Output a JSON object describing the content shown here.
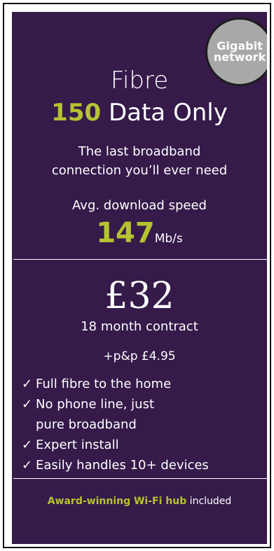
{
  "badge": {
    "line1": "Gigabit",
    "line2": "network"
  },
  "plan": {
    "title_line1": "Fibre",
    "speed_tier": "150",
    "title_rest": " Data Only",
    "tagline_line1": "The last broadband",
    "tagline_line2": "connection you’ll ever need"
  },
  "speed": {
    "label": "Avg. download speed",
    "value": "147",
    "unit": "Mb/s"
  },
  "pricing": {
    "price": "£32",
    "contract": "18 month contract",
    "postage": "+p&p £4.95"
  },
  "features": [
    {
      "tick": "✓",
      "lines": [
        "Full fibre to the home"
      ]
    },
    {
      "tick": "✓",
      "lines": [
        "No phone line, just",
        "pure broadband"
      ]
    },
    {
      "tick": "✓",
      "lines": [
        "Expert install"
      ]
    },
    {
      "tick": "✓",
      "lines": [
        "Easily handles 10+ devices"
      ]
    }
  ],
  "footer": {
    "highlight": "Award-winning Wi-Fi hub",
    "rest": " included"
  },
  "colors": {
    "card_background": "#351a4a",
    "accent": "#b5c330",
    "badge_background": "#a8a8a8"
  }
}
